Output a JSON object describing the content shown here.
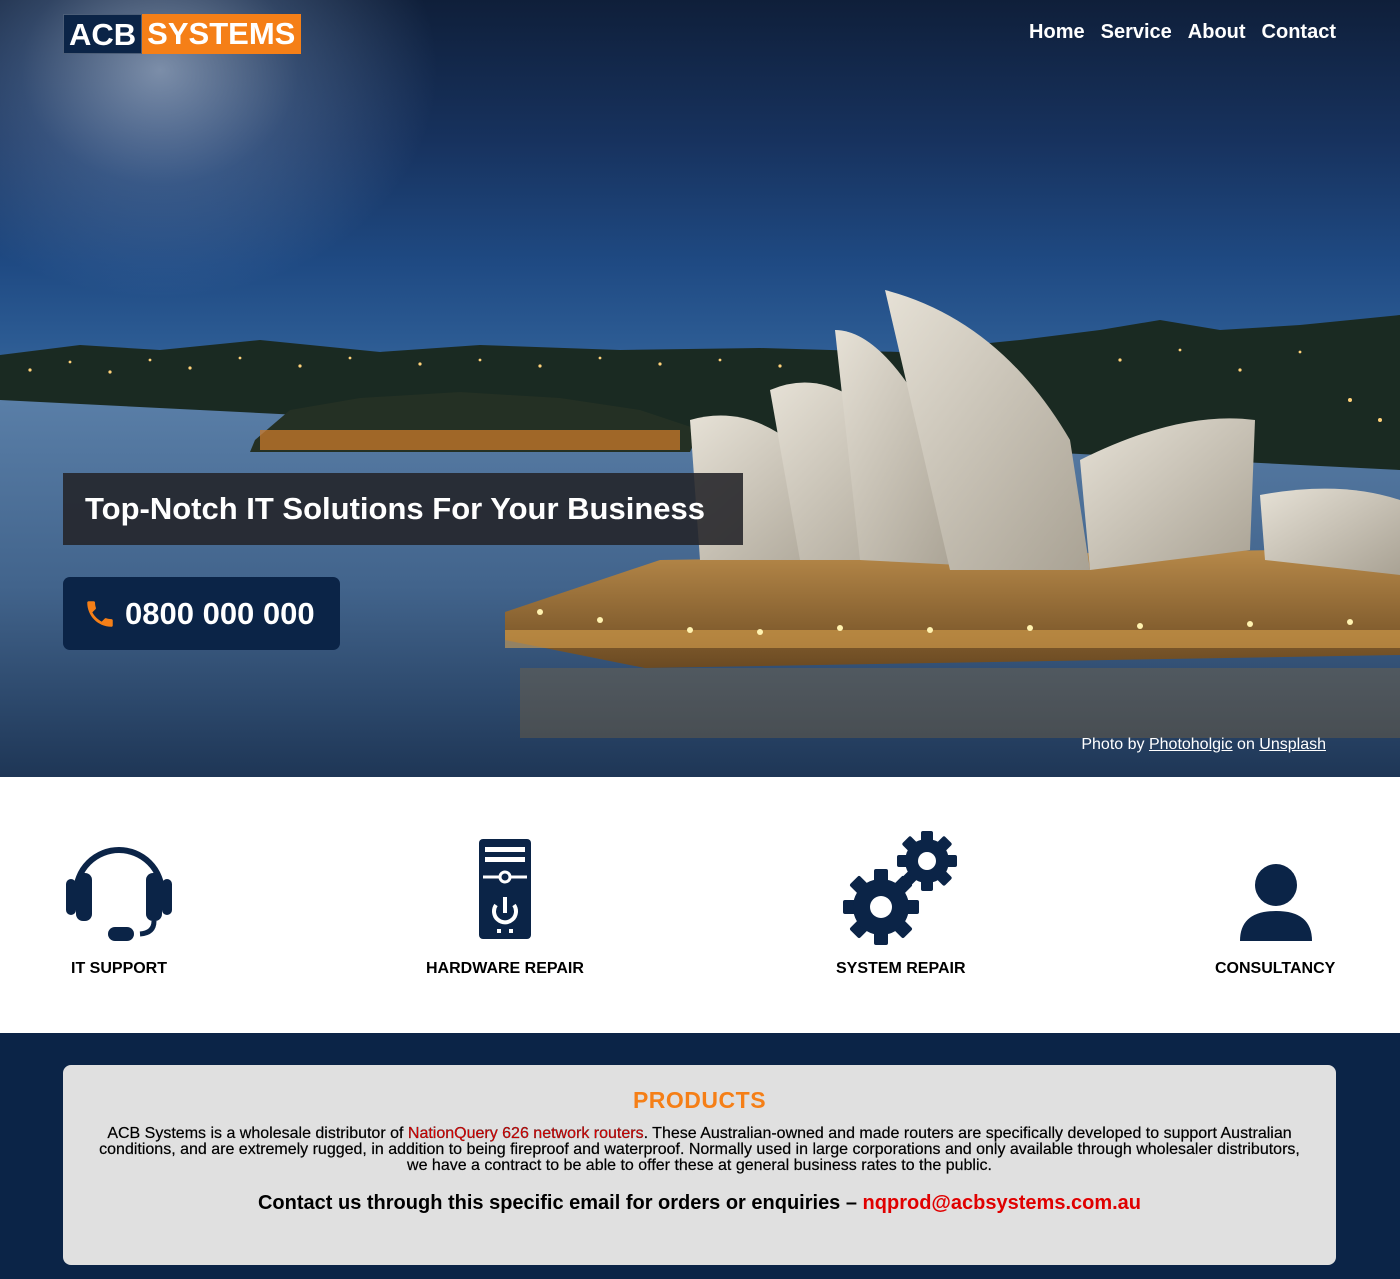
{
  "header": {
    "brand_part1": "ACB",
    "brand_part2": "SYSTEMS",
    "nav": [
      {
        "label": "Home"
      },
      {
        "label": "Service"
      },
      {
        "label": "About"
      },
      {
        "label": "Contact"
      }
    ]
  },
  "hero": {
    "tagline": "Top-Notch IT Solutions For Your Business",
    "phone": "0800 000 000",
    "phone_icon": "phone-icon",
    "credit_prefix": "Photo by",
    "credit_author": "Photoholgic",
    "credit_middle": "on",
    "credit_site": "Unsplash"
  },
  "services": [
    {
      "label": "IT SUPPORT",
      "icon": "headset-icon"
    },
    {
      "label": "HARDWARE REPAIR",
      "icon": "computer-tower-icon"
    },
    {
      "label": "SYSTEM REPAIR",
      "icon": "gears-icon"
    },
    {
      "label": "CONSULTANCY",
      "icon": "user-icon"
    }
  ],
  "products": {
    "title": "PRODUCTS",
    "desc_before": "ACB Systems is a wholesale distributor of ",
    "desc_highlight": "NationQuery 626 network routers",
    "desc_after": ". These Australian-owned and made routers are specifically developed to support Australian conditions, and are extremely rugged, in addition to being fireproof and waterproof. Normally used in large corporations and only available through wholesaler distributors, we have a contract to be able to offer these at general business rates to the public.",
    "contact_text": "Contact us through this specific email for orders or enquiries – ",
    "email": "nqprod@acbsystems.com.au"
  },
  "colors": {
    "navy": "#0b2447",
    "orange": "#f57f17",
    "red_link": "#e00000",
    "card_bg": "#e0e0e0"
  }
}
